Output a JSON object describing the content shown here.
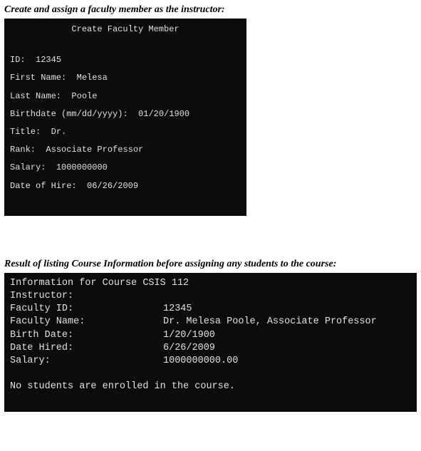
{
  "section1": {
    "heading": "Create and assign a faculty member as the instructor:",
    "title": "Create Faculty Member",
    "fields": {
      "id_label": "ID:",
      "id_value": "12345",
      "first_name_label": "First Name:",
      "first_name_value": "Melesa",
      "last_name_label": "Last Name:",
      "last_name_value": "Poole",
      "birthdate_label": "Birthdate (mm/dd/yyyy):",
      "birthdate_value": "01/20/1900",
      "title_label": "Title:",
      "title_value": "Dr.",
      "rank_label": "Rank:",
      "rank_value": "Associate Professor",
      "salary_label": "Salary:",
      "salary_value": "1000000000",
      "hire_label": "Date of Hire:",
      "hire_value": "06/26/2009"
    }
  },
  "section2": {
    "heading": "Result of listing Course Information before assigning any students to the course:",
    "info_header": "Information for Course CSIS 112",
    "instructor_label": "Instructor:",
    "rows": {
      "faculty_id_label": "Faculty ID:",
      "faculty_id_value": "12345",
      "faculty_name_label": "Faculty Name:",
      "faculty_name_value": "Dr. Melesa Poole, Associate Professor",
      "birth_label": "Birth Date:",
      "birth_value": "1/20/1900",
      "hired_label": "Date Hired:",
      "hired_value": "6/26/2009",
      "salary_label": "Salary:",
      "salary_value": "1000000000.00"
    },
    "footer": "No students are enrolled in the course."
  }
}
